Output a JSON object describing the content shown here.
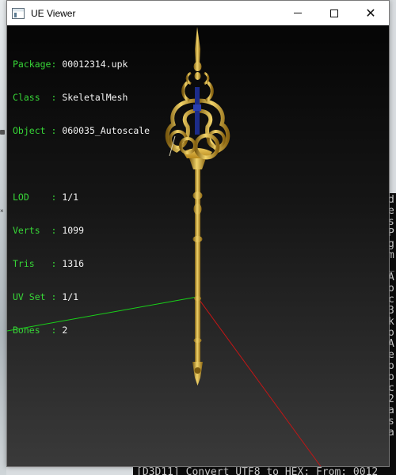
{
  "window": {
    "title": "UE Viewer",
    "icon": "app-window-icon",
    "controls": [
      "minimize-icon",
      "maximize-icon",
      "close-icon"
    ]
  },
  "info": {
    "package_key": "Package:",
    "package": "00012314.upk",
    "class_key": "Class  :",
    "class": "SkeletalMesh",
    "object_key": "Object :",
    "object": "060035_Autoscale",
    "lod_key": "LOD    :",
    "lod": "1/1",
    "verts_key": "Verts  :",
    "verts": "1099",
    "tris_key": "Tris   :",
    "tris": "1316",
    "uvset_key": "UV Set :",
    "uvset": "1/1",
    "bones_key": "Bones  :",
    "bones": "2"
  },
  "colors": {
    "label_green": "#37d637",
    "value_white": "#f2f2f2",
    "axis_green": "#19d119",
    "axis_red": "#c21616",
    "mesh_gold": "#c9a227"
  },
  "console": {
    "right_chars": [
      "d",
      "e",
      "s",
      "P",
      "g",
      "m",
      "_",
      "A",
      "o",
      "c",
      "3",
      "k",
      "o",
      "A",
      "e",
      "o",
      "o",
      "c",
      "2",
      "a",
      "s",
      "a"
    ],
    "bottom_line": "[D3D11] Convert UTF8 to HEX: From: 0012"
  }
}
